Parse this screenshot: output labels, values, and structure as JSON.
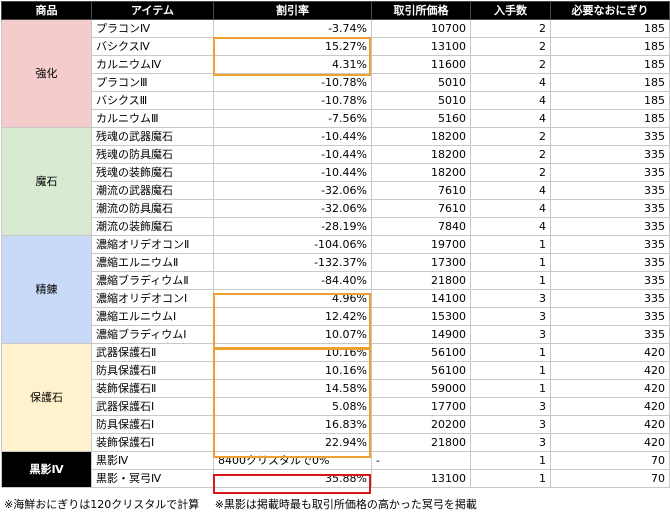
{
  "headers": {
    "category": "商品",
    "item": "アイテム",
    "discount": "割引率",
    "price": "取引所価格",
    "qty": "入手数",
    "onigiri": "必要なおにぎり"
  },
  "groups": [
    {
      "label": "強化",
      "rows": [
        {
          "item": "プラコンⅣ",
          "discount": "-3.74%",
          "price": "10700",
          "qty": "2",
          "onigiri": "185"
        },
        {
          "item": "バシクスⅣ",
          "discount": "15.27%",
          "price": "13100",
          "qty": "2",
          "onigiri": "185"
        },
        {
          "item": "カルニウムⅣ",
          "discount": "4.31%",
          "price": "11600",
          "qty": "2",
          "onigiri": "185"
        },
        {
          "item": "プラコンⅢ",
          "discount": "-10.78%",
          "price": "5010",
          "qty": "4",
          "onigiri": "185"
        },
        {
          "item": "バシクスⅢ",
          "discount": "-10.78%",
          "price": "5010",
          "qty": "4",
          "onigiri": "185"
        },
        {
          "item": "カルニウムⅢ",
          "discount": "-7.56%",
          "price": "5160",
          "qty": "4",
          "onigiri": "185"
        }
      ]
    },
    {
      "label": "魔石",
      "rows": [
        {
          "item": "残魂の武器魔石",
          "discount": "-10.44%",
          "price": "18200",
          "qty": "2",
          "onigiri": "335"
        },
        {
          "item": "残魂の防具魔石",
          "discount": "-10.44%",
          "price": "18200",
          "qty": "2",
          "onigiri": "335"
        },
        {
          "item": "残魂の装飾魔石",
          "discount": "-10.44%",
          "price": "18200",
          "qty": "2",
          "onigiri": "335"
        },
        {
          "item": "潮流の武器魔石",
          "discount": "-32.06%",
          "price": "7610",
          "qty": "4",
          "onigiri": "335"
        },
        {
          "item": "潮流の防具魔石",
          "discount": "-32.06%",
          "price": "7610",
          "qty": "4",
          "onigiri": "335"
        },
        {
          "item": "潮流の装飾魔石",
          "discount": "-28.19%",
          "price": "7840",
          "qty": "4",
          "onigiri": "335"
        }
      ]
    },
    {
      "label": "精錬",
      "rows": [
        {
          "item": "濃縮オリデオコンⅡ",
          "discount": "-104.06%",
          "price": "19700",
          "qty": "1",
          "onigiri": "335"
        },
        {
          "item": "濃縮エルニウムⅡ",
          "discount": "-132.37%",
          "price": "17300",
          "qty": "1",
          "onigiri": "335"
        },
        {
          "item": "濃縮ブラディウムⅡ",
          "discount": "-84.40%",
          "price": "21800",
          "qty": "1",
          "onigiri": "335"
        },
        {
          "item": "濃縮オリデオコンⅠ",
          "discount": "4.96%",
          "price": "14100",
          "qty": "3",
          "onigiri": "335"
        },
        {
          "item": "濃縮エルニウムⅠ",
          "discount": "12.42%",
          "price": "15300",
          "qty": "3",
          "onigiri": "335"
        },
        {
          "item": "濃縮ブラディウムⅠ",
          "discount": "10.07%",
          "price": "14900",
          "qty": "3",
          "onigiri": "335"
        }
      ]
    },
    {
      "label": "保護石",
      "rows": [
        {
          "item": "武器保護石Ⅱ",
          "discount": "10.16%",
          "price": "56100",
          "qty": "1",
          "onigiri": "420"
        },
        {
          "item": "防具保護石Ⅱ",
          "discount": "10.16%",
          "price": "56100",
          "qty": "1",
          "onigiri": "420"
        },
        {
          "item": "装飾保護石Ⅱ",
          "discount": "14.58%",
          "price": "59000",
          "qty": "1",
          "onigiri": "420"
        },
        {
          "item": "武器保護石Ⅰ",
          "discount": "5.08%",
          "price": "17700",
          "qty": "3",
          "onigiri": "420"
        },
        {
          "item": "防具保護石Ⅰ",
          "discount": "16.83%",
          "price": "20200",
          "qty": "3",
          "onigiri": "420"
        },
        {
          "item": "装飾保護石Ⅰ",
          "discount": "22.94%",
          "price": "21800",
          "qty": "3",
          "onigiri": "420"
        }
      ]
    }
  ],
  "kokuei": {
    "label": "黒影Ⅳ",
    "rows": [
      {
        "item": "黒影Ⅳ",
        "discount": "8400クリスタルで0%",
        "price": "-",
        "qty": "1",
        "onigiri": "70"
      },
      {
        "item": "黒影・冥弓Ⅳ",
        "discount": "35.88%",
        "price": "13100",
        "qty": "1",
        "onigiri": "70"
      }
    ]
  },
  "footnotes": [
    "※海鮮おにぎりは120クリスタルで計算",
    "※黒影は掲載時最も取引所価格の高かった冥弓を掲載"
  ],
  "colors": {
    "header_bg": "#000000",
    "kyoka": "#f4cccc",
    "maseki": "#d9ead3",
    "seiren": "#c9daf8",
    "hogo": "#fff2cc",
    "highlight_orange": "#f0a030",
    "highlight_red": "#d81818"
  }
}
